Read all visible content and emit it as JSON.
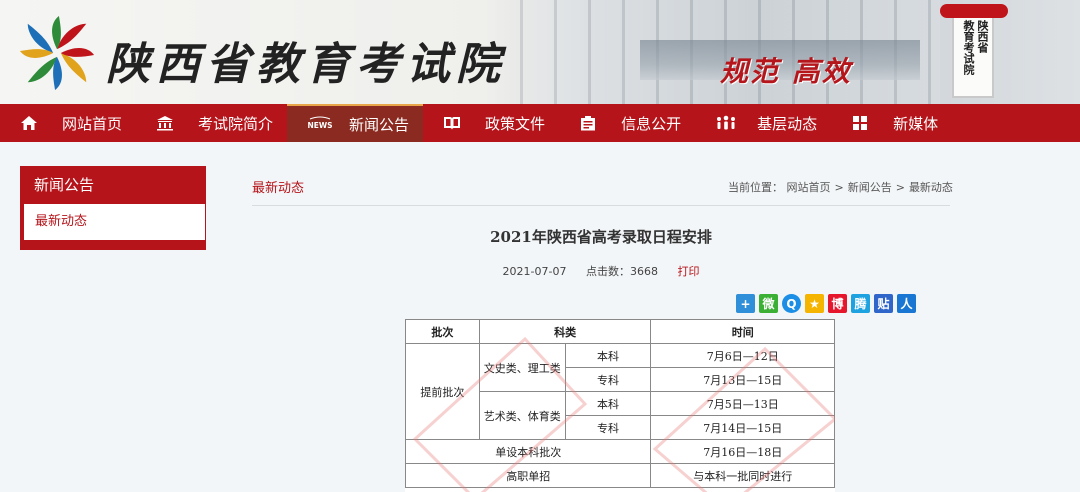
{
  "header": {
    "site_title": "陕西省教育考试院",
    "slogan": "规范 高效",
    "plaque_col1": "陕西省",
    "plaque_col2": "教育考试院",
    "brand_color": "#b4141a"
  },
  "nav": {
    "items": [
      {
        "label": "网站首页",
        "icon": "home-icon"
      },
      {
        "label": "考试院简介",
        "icon": "building-icon"
      },
      {
        "label": "新闻公告",
        "icon": "news-icon",
        "active": true
      },
      {
        "label": "政策文件",
        "icon": "book-icon"
      },
      {
        "label": "信息公开",
        "icon": "clipboard-icon"
      },
      {
        "label": "基层动态",
        "icon": "people-icon"
      },
      {
        "label": "新媒体",
        "icon": "grid-icon"
      }
    ],
    "news_icon_text": "NEWS"
  },
  "sidebar": {
    "title": "新闻公告",
    "items": [
      {
        "label": "最新动态"
      }
    ]
  },
  "main": {
    "section_title": "最新动态",
    "breadcrumb": {
      "prefix": "当前位置：",
      "items": [
        "网站首页",
        "新闻公告",
        "最新动态"
      ],
      "separator": ">"
    },
    "article": {
      "title": "2021年陕西省高考录取日程安排",
      "date": "2021-07-07",
      "clicks_label": "点击数：",
      "clicks": "3668",
      "print_label": "打印"
    },
    "share_icons": [
      "add-share-icon",
      "wechat-icon",
      "qq-icon",
      "qzone-icon",
      "weibo-icon",
      "tencent-weibo-icon",
      "tieba-icon",
      "renren-icon"
    ],
    "share_glyphs": [
      "+",
      "微",
      "Q",
      "★",
      "博",
      "腾",
      "贴",
      "人"
    ],
    "table": {
      "headers": [
        "批次",
        "科类",
        "时间"
      ],
      "group1": "提前批次",
      "sub1": "文史类、理工类",
      "sub2": "艺术类、体育类",
      "level_undergrad": "本科",
      "level_junior": "专科",
      "r1_time": "7月6日—12日",
      "r2_time": "7月13日—15日",
      "r3_time": "7月5日—13日",
      "r4_time": "7月14日—15日",
      "r5_label": "单设本科批次",
      "r5_time": "7月16日—18日",
      "r6_label": "高职单招",
      "r6_time": "与本科一批同时进行"
    }
  }
}
